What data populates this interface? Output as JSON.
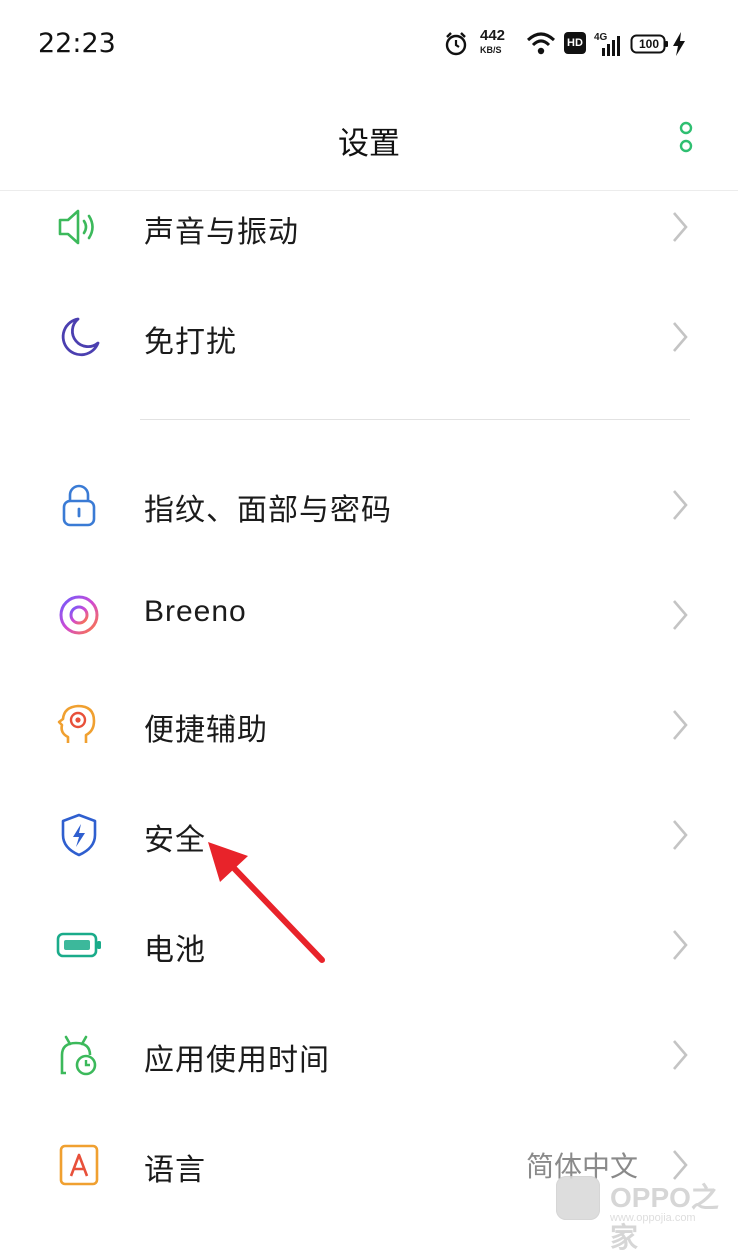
{
  "status_bar": {
    "time": "22:23",
    "net_speed": "442",
    "net_speed_unit": "KB/S",
    "hd": "HD",
    "network": "4G",
    "battery": "100"
  },
  "header": {
    "title": "设置",
    "more_icon": "vertical-dots-icon",
    "accent_color": "#2fbf71"
  },
  "settings": [
    {
      "label": "声音与振动",
      "icon": "speaker-icon",
      "color": "#3cb95b"
    },
    {
      "label": "免打扰",
      "icon": "moon-icon",
      "color": "#4b3fb0"
    },
    {
      "label": "指纹、面部与密码",
      "icon": "lock-icon",
      "color": "#3a7bd5"
    },
    {
      "label": "Breeno",
      "icon": "breeno-icon",
      "color": "#b84bd6"
    },
    {
      "label": "便捷辅助",
      "icon": "head-target-icon",
      "color": "#f0a030"
    },
    {
      "label": "安全",
      "icon": "shield-bolt-icon",
      "color": "#2f5fcf"
    },
    {
      "label": "电池",
      "icon": "battery-icon",
      "color": "#1aab8a"
    },
    {
      "label": "应用使用时间",
      "icon": "android-clock-icon",
      "color": "#3cb95b"
    },
    {
      "label": "语言",
      "icon": "letter-a-icon",
      "value": "简体中文",
      "color": "#f0a030"
    }
  ],
  "annotation_color": "#e8232a",
  "watermark": {
    "text": "OPPO之家",
    "url": "www.oppojia.com"
  }
}
